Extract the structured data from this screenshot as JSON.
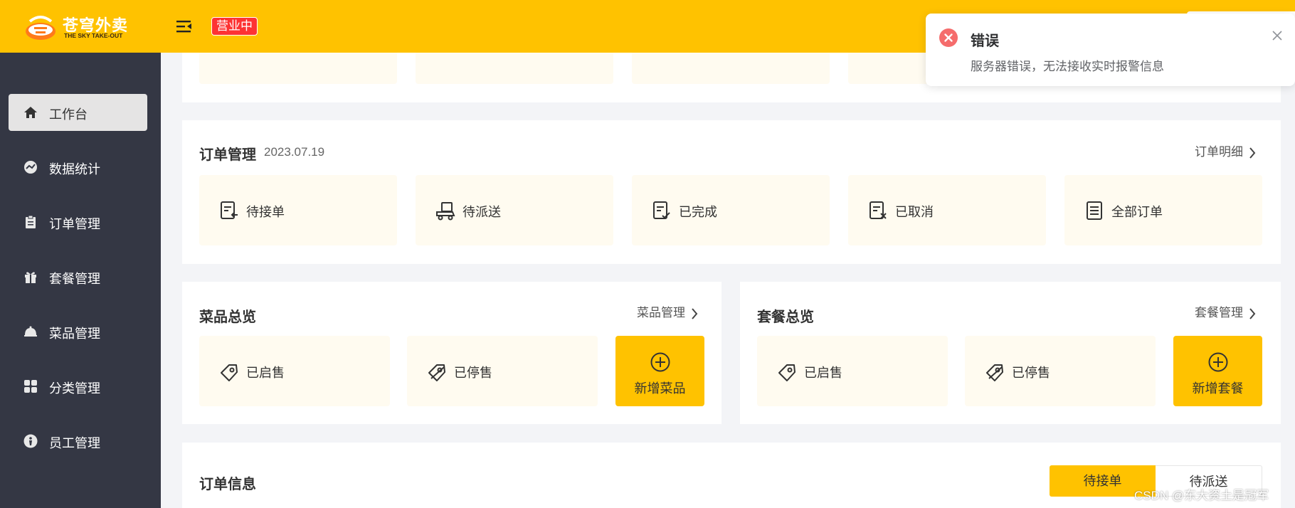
{
  "colors": {
    "brand": "#ffc200",
    "sidebar": "#343744",
    "tile_bg": "#fffbf0",
    "error": "#f56c6c",
    "badge": "#fd3333"
  },
  "header": {
    "logo_title": "苍穹外卖",
    "logo_subtitle": "THE SKY TAKE-OUT",
    "status_badge": "营业中",
    "menu_icon": "menu-fold-icon"
  },
  "sidebar": {
    "items": [
      {
        "label": "工作台",
        "icon": "home-icon",
        "active": true
      },
      {
        "label": "数据统计",
        "icon": "chart-icon",
        "active": false
      },
      {
        "label": "订单管理",
        "icon": "clipboard-icon",
        "active": false
      },
      {
        "label": "套餐管理",
        "icon": "gift-icon",
        "active": false
      },
      {
        "label": "菜品管理",
        "icon": "cloche-icon",
        "active": false
      },
      {
        "label": "分类管理",
        "icon": "grid-icon",
        "active": false
      },
      {
        "label": "员工管理",
        "icon": "employee-icon",
        "active": false
      }
    ]
  },
  "order_management": {
    "title": "订单管理",
    "date": "2023.07.19",
    "link": "订单明细",
    "tiles": [
      {
        "label": "待接单",
        "icon": "pending-order-icon"
      },
      {
        "label": "待派送",
        "icon": "delivery-icon"
      },
      {
        "label": "已完成",
        "icon": "completed-icon"
      },
      {
        "label": "已取消",
        "icon": "cancelled-icon"
      },
      {
        "label": "全部订单",
        "icon": "all-orders-icon"
      }
    ]
  },
  "dish_overview": {
    "title": "菜品总览",
    "link": "菜品管理",
    "tiles": [
      {
        "label": "已启售",
        "icon": "tag-icon"
      },
      {
        "label": "已停售",
        "icon": "tag-off-icon"
      }
    ],
    "add_label": "新增菜品"
  },
  "setmeal_overview": {
    "title": "套餐总览",
    "link": "套餐管理",
    "tiles": [
      {
        "label": "已启售",
        "icon": "tag-icon"
      },
      {
        "label": "已停售",
        "icon": "tag-off-icon"
      }
    ],
    "add_label": "新增套餐"
  },
  "order_info": {
    "title": "订单信息",
    "tabs": [
      {
        "label": "待接单",
        "active": true
      },
      {
        "label": "待派送",
        "active": false
      }
    ]
  },
  "toast": {
    "type": "error",
    "title": "错误",
    "message": "服务器错误，无法接收实时报警信息"
  },
  "watermark": "CSDN @东大资土是冠军"
}
